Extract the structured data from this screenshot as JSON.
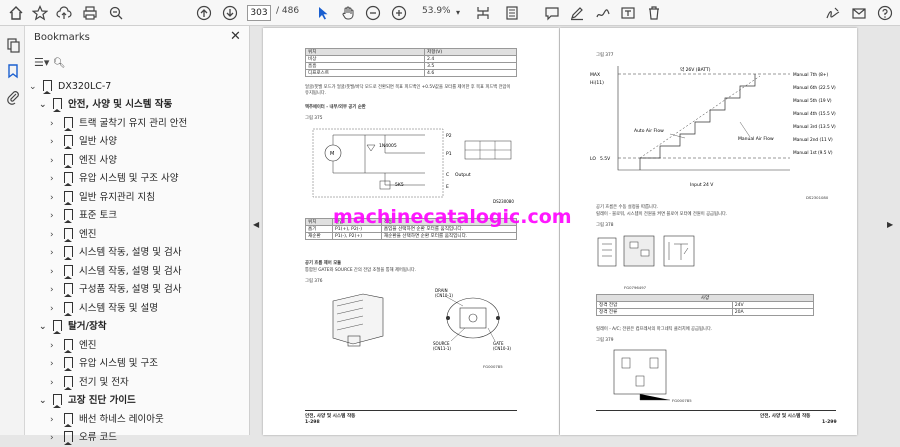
{
  "toolbar": {
    "page_current": "303",
    "page_total": "/ 486",
    "zoom": "53.9%"
  },
  "sidebar": {
    "title": "Bookmarks",
    "items": [
      {
        "label": "DX320LC-7"
      },
      {
        "label": "안전, 사양 및 시스템 작동"
      },
      {
        "label": "트랙 굴착기 유지 관리 안전"
      },
      {
        "label": "일반 사양"
      },
      {
        "label": "엔진 사양"
      },
      {
        "label": "유압 시스템 및 구조 사양"
      },
      {
        "label": "일반 유지관리 지침"
      },
      {
        "label": "표준 토크"
      },
      {
        "label": "엔진"
      },
      {
        "label": "시스템 작동, 설명 및 검사"
      },
      {
        "label": "시스템 작동, 설명 및 검사"
      },
      {
        "label": "구성품 작동, 설명 및 검사"
      },
      {
        "label": "시스템 작동 및 설명"
      },
      {
        "label": "탈거/장착"
      },
      {
        "label": "엔진"
      },
      {
        "label": "유압 시스템 및 구조"
      },
      {
        "label": "전기 및 전자"
      },
      {
        "label": "고장 진단 가이드"
      },
      {
        "label": "배선 하네스 레이아웃"
      },
      {
        "label": "오류 코드"
      }
    ]
  },
  "left_page": {
    "table1_header": [
      "위치",
      "저항(V)"
    ],
    "table1_rows": [
      [
        "비상",
        "2.4"
      ],
      [
        "흠흠",
        "3.5"
      ],
      [
        "디프로스트",
        "4.6"
      ]
    ],
    "note1": "얼굴/풋밸 모드가 얼굴/풋밸/바닥 모드로 전환되면 목표 피드백인 +0.5V값을 모터를 제어한 후 목표 피드백 전압이",
    "note1b": "유지됩니다.",
    "heading1": "액추에이터 - 내부/외부 공기 순환",
    "fig375": "그림 375",
    "diode": "1N4005",
    "p2": "P2",
    "p1": "P1",
    "c": "C",
    "output": "Output",
    "e": "E",
    "res": "5K5",
    "code1": "DS230080",
    "table2_header": [
      "위치",
      "전압",
      "작동"
    ],
    "table2_rows": [
      [
        "흡기",
        "P1(+), P2(-)",
        "흡입을 선택하면 순환 모터를 움직입니다."
      ],
      [
        "재순환",
        "P1(-), P2(+)",
        "재순환을 선택하면 순환 모터를 움직입니다."
      ]
    ],
    "heading2": "공기 흐름 제어 모듈",
    "note2": "통합된 GATE와 SOURCE 간의 전압 조절을 통해 제어됩니다.",
    "fig376": "그림 376",
    "drain": "DRAIN",
    "drain_code": "(CN10-1)",
    "source": "SOURCE",
    "source_code": "(CN11-1)",
    "gate": "GATE",
    "gate_code": "(CN10-3)",
    "code2": "FG000785",
    "footer_title": "안전, 사양 및 시스템 작동",
    "footer_page": "1-298"
  },
  "right_page": {
    "fig377": "그림 377",
    "max_label": "MAX",
    "hi_label": "Hi(11)",
    "lo_label": "LO",
    "lo_val": "5.5V",
    "ov_label": "약 26V (BATT)",
    "auto_air": "Auto Air Flow",
    "manual_air": "Manual Air Flow",
    "input_label": "Input 24 V",
    "manual_levels": [
      "Manual 7th (8+)",
      "Manual 6th (22.5 V)",
      "Manual 5th (19 V)",
      "Manual 4th (15.5 V)",
      "Manual 3rd (13.5 V)",
      "Manual 2nd (11 V)",
      "Manual 1st (9.5 V)"
    ],
    "code3": "DS2301080",
    "note3": "공기 흐름은 수동 설정을 따릅니다.",
    "heading3": "릴레이 - 블로워, 시스템이 전원을 켜면 블로어 모터에 전원이 공급됩니다.",
    "fig378": "그림 378",
    "code4": "FG0796497",
    "spec_title": "사양",
    "spec_rows": [
      [
        "정격 전압",
        "24V"
      ],
      [
        "정격 전류",
        "20A"
      ]
    ],
    "heading4": "릴레이 - A/C; 전원은 컴프레서의 마그네틱 클러치에 공급됩니다.",
    "fig379": "그림 379",
    "code5": "FG000785",
    "footer_title": "안전, 사양 및 시스템 작동",
    "footer_page": "1-299"
  },
  "watermark": "machinecatalogic.com"
}
